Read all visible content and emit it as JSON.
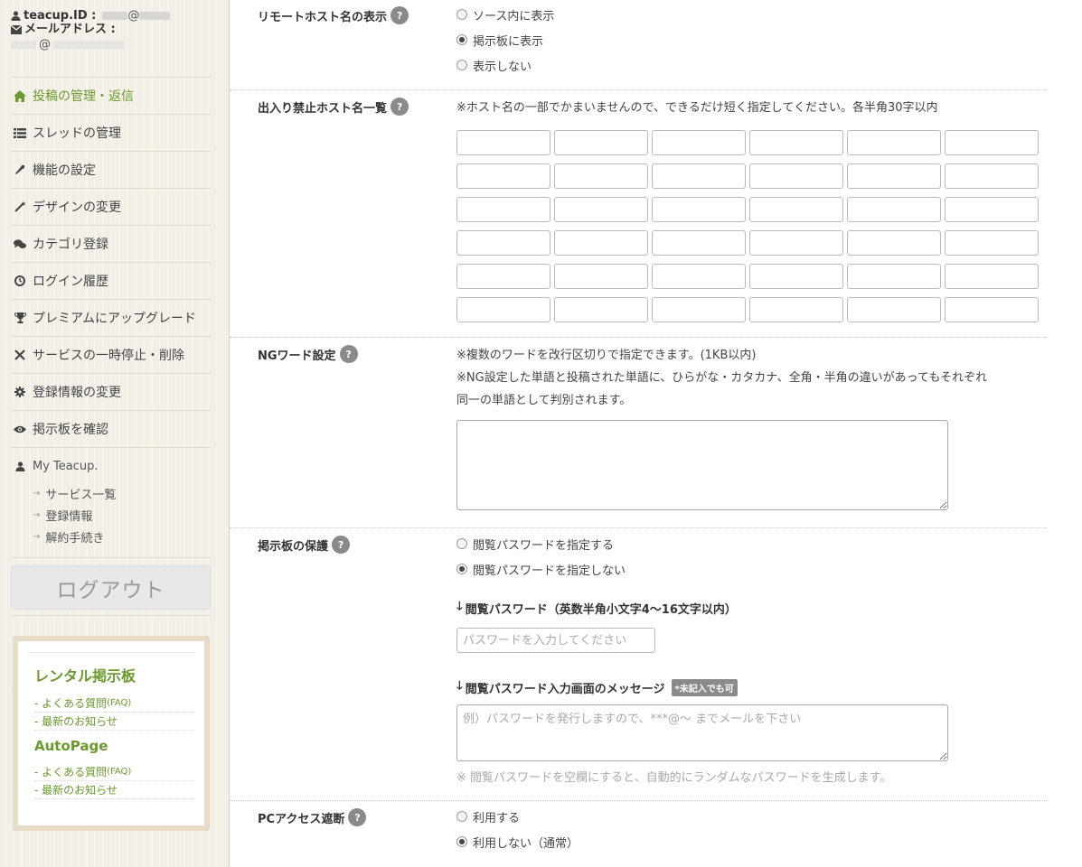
{
  "account": {
    "id_label": "teacup.ID :",
    "id_at": "@",
    "mail_label": "メールアドレス :",
    "mail_at": "@"
  },
  "nav": {
    "items": [
      {
        "label": "投稿の管理・返信",
        "icon": "home-icon",
        "active": true
      },
      {
        "label": "スレッドの管理",
        "icon": "list-icon"
      },
      {
        "label": "機能の設定",
        "icon": "wrench-icon"
      },
      {
        "label": "デザインの変更",
        "icon": "magic-wand-icon"
      },
      {
        "label": "カテゴリ登録",
        "icon": "chat-bubbles-icon"
      },
      {
        "label": "ログイン履歴",
        "icon": "clock-icon"
      },
      {
        "label": "プレミアムにアップグレード",
        "icon": "trophy-icon"
      },
      {
        "label": "サービスの一時停止・削除",
        "icon": "close-icon"
      },
      {
        "label": "登録情報の変更",
        "icon": "gear-icon"
      },
      {
        "label": "掲示板を確認",
        "icon": "eye-icon"
      }
    ],
    "my_teacup": {
      "label": "My Teacup.",
      "items": [
        "サービス一覧",
        "登録情報",
        "解約手続き"
      ]
    },
    "logout_label": "ログアウト"
  },
  "promo": {
    "rental": {
      "title": "レンタル掲示板",
      "faq_text": "- よくある質問",
      "faq_suffix": "(FAQ)",
      "news": "- 最新のお知らせ"
    },
    "autopage": {
      "title": "AutoPage",
      "faq_text": "- よくある質問",
      "faq_suffix": "(FAQ)",
      "news": "- 最新のお知らせ"
    }
  },
  "sections": {
    "remote_host": {
      "label": "リモートホスト名の表示",
      "options": [
        {
          "label": "ソース内に表示",
          "selected": false
        },
        {
          "label": "掲示板に表示",
          "selected": true
        },
        {
          "label": "表示しない",
          "selected": false
        }
      ]
    },
    "banned_hosts": {
      "label": "出入り禁止ホスト名一覧",
      "note": "※ホスト名の一部でかまいませんので、できるだけ短く指定してください。各半角30字以内",
      "rows": 6,
      "cols": 6
    },
    "ng_words": {
      "label": "NGワード設定",
      "note1": "※複数のワードを改行区切りで指定できます。(1KB以内)",
      "note2": "※NG設定した単語と投稿された単語に、ひらがな・カタカナ、全角・半角の違いがあってもそれぞれ",
      "note3": "同一の単語として判別されます。"
    },
    "protection": {
      "label": "掲示板の保護",
      "options": [
        {
          "label": "閲覧パスワードを指定する",
          "selected": false
        },
        {
          "label": "閲覧パスワードを指定しない",
          "selected": true
        }
      ],
      "password_label": "閲覧パスワード（英数半角小文字4〜16文字以内）",
      "password_placeholder": "パスワードを入力してください",
      "message_label": "閲覧パスワード入力画面のメッセージ",
      "message_tag": "*未記入でも可",
      "message_placeholder": "例）パスワードを発行しますので、***@〜 までメールを下さい",
      "note": "※ 閲覧パスワードを空欄にすると、自動的にランダムなパスワードを生成します。"
    },
    "pc_block": {
      "label": "PCアクセス遮断",
      "options": [
        {
          "label": "利用する",
          "selected": false
        },
        {
          "label": "利用しない（通常）",
          "selected": true
        }
      ]
    }
  },
  "help_glyph": "?",
  "colors": {
    "accent": "#6a9a2e",
    "help_badge": "#8a8a8a"
  }
}
